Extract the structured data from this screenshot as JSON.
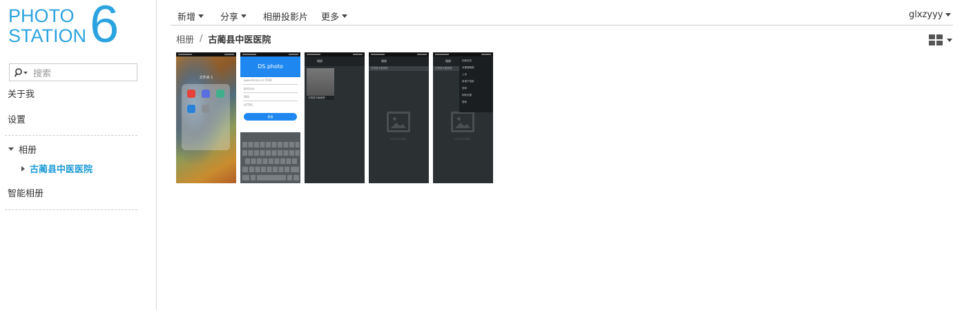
{
  "app": {
    "logo_line1": "PHOTO",
    "logo_line2": "STATION",
    "logo_version": "6",
    "brand_color": "#2ba3e0"
  },
  "sidebar": {
    "search_placeholder": "搜索",
    "about": "关于我",
    "settings": "设置",
    "albums_label": "相册",
    "album_child": "古蔺县中医医院",
    "smart_album": "智能相册",
    "active_color": "#1a9ad6"
  },
  "toolbar": {
    "new_label": "新增",
    "share_label": "分享",
    "slideshow_label": "相册投影片",
    "more_label": "更多",
    "user_label": "glxzyyy"
  },
  "breadcrumb": {
    "root": "相册",
    "separator": "/",
    "current": "古蔺县中医医院"
  },
  "view": {
    "icon": "grid-view-icon"
  },
  "thumbnails": {
    "t1_folder_title": "文件夹 1",
    "t2_title": "DS photo",
    "t2_field1": "www.dsrxsv.cn:5500",
    "t2_field2": "glxzyyy",
    "t2_field3": "密码",
    "t2_field4": "HTTPS",
    "t2_login": "登录",
    "t3_appbar": "相册",
    "t3_album": "古蔺县中医医院",
    "t4_appbar": "相册",
    "t4_subbar": "古蔺县中医医院",
    "t4_empty": "尚未有任何照片",
    "t5_appbar": "相册",
    "t5_subbar": "古蔺县中医医院",
    "t5_empty": "尚未有任何照片",
    "t5_menu": [
      "相册信息",
      "设置缩略图",
      "上传",
      "新增子相册",
      "选择",
      "刷新设置",
      "搜索"
    ]
  }
}
